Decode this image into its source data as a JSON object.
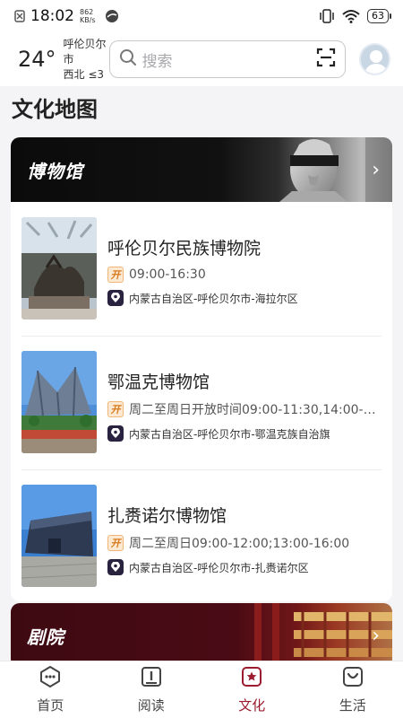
{
  "status_bar": {
    "time": "18:02",
    "net_speed_value": "862",
    "net_speed_unit": "KB/s",
    "battery": "63"
  },
  "header": {
    "temperature": "24°",
    "city": "呼伦贝尔市",
    "wind": "西北 ≤3",
    "search_placeholder": "搜索"
  },
  "section_title": "文化地图",
  "categories": [
    {
      "title": "博物馆",
      "items": [
        {
          "name": "呼伦贝尔民族博物院",
          "hours": "09:00-16:30",
          "address": "内蒙古自治区-呼伦贝尔市-海拉尔区"
        },
        {
          "name": "鄂温克博物馆",
          "hours": "周二至周日开放时间09:00-11:30,14:00-…",
          "address": "内蒙古自治区-呼伦贝尔市-鄂温克族自治旗"
        },
        {
          "name": "扎赉诺尔博物馆",
          "hours": "周二至周日09:00-12:00;13:00-16:00",
          "address": "内蒙古自治区-呼伦贝尔市-扎赉诺尔区"
        }
      ]
    },
    {
      "title": "剧院"
    }
  ],
  "bottom_nav": [
    {
      "label": "首页",
      "icon": "home-icon"
    },
    {
      "label": "阅读",
      "icon": "book-icon"
    },
    {
      "label": "文化",
      "icon": "culture-icon",
      "active": true
    },
    {
      "label": "生活",
      "icon": "bag-icon"
    }
  ],
  "colors": {
    "accent": "#9c1b2e",
    "open_badge": "#d77a1e",
    "theatre_banner": "#4a0b15"
  }
}
